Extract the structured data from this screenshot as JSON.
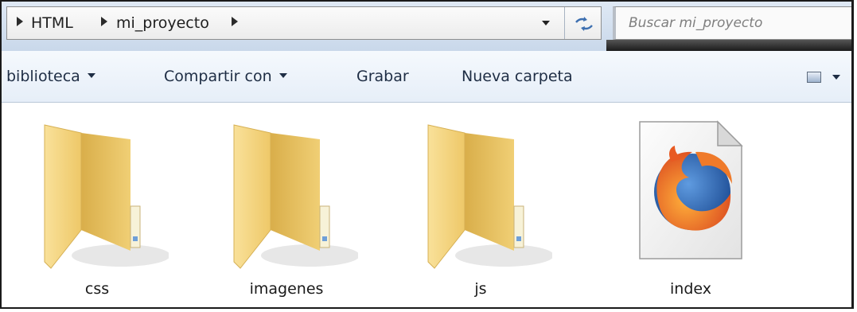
{
  "address_bar": {
    "breadcrumbs": [
      "HTML",
      "mi_proyecto"
    ],
    "search_placeholder": "Buscar mi_proyecto"
  },
  "toolbar": {
    "items": [
      {
        "label": "biblioteca",
        "has_dropdown": true
      },
      {
        "label": "Compartir con",
        "has_dropdown": true
      },
      {
        "label": "Grabar",
        "has_dropdown": false
      },
      {
        "label": "Nueva carpeta",
        "has_dropdown": false
      }
    ]
  },
  "files": [
    {
      "name": "css",
      "type": "folder",
      "icon": "folder-icon"
    },
    {
      "name": "imagenes",
      "type": "folder",
      "icon": "folder-icon"
    },
    {
      "name": "js",
      "type": "folder",
      "icon": "folder-icon"
    },
    {
      "name": "index",
      "type": "html-file",
      "icon": "firefox-document-icon"
    }
  ],
  "colors": {
    "folder_front": "#f6d57e",
    "folder_back": "#e7bf5d",
    "toolbar_text": "#1e2d44",
    "firefox_orange": "#e8692a",
    "firefox_blue": "#1f5ea8"
  }
}
